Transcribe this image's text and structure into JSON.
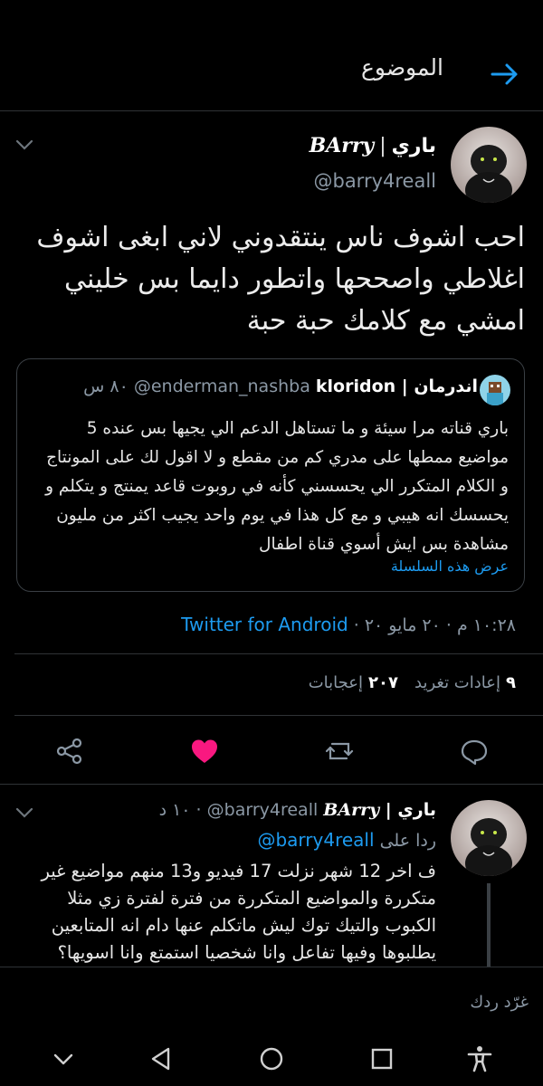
{
  "header": {
    "title": "الموضوع",
    "back_icon": "arrow-right-icon"
  },
  "tweet": {
    "display_name_ar": "باري",
    "display_name_sep": "|",
    "display_name_latin": "BArry",
    "handle": "@barry4reall",
    "body": "احب اشوف ناس ينتقدوني لاني ابغى اشوف اغلاطي واصححها واتطور دايما بس خليني امشي مع كلامك حبة حبة",
    "quote": {
      "name": "اندرمان | kloridon",
      "handle": "@enderman_nashba",
      "time": "٨٠ س",
      "body": "باري قناته مرا سيئة و ما تستاهل الدعم الي يجيها بس عنده 5 مواضيع ممطها على مدري كم من مقطع و لا اقول لك على المونتاج و الكلام المتكرر الي يحسسني كأنه في روبوت قاعد يمنتج و يتكلم و يحسسك انه هيبي و مع كل هذا في يوم واحد يجيب اكثر من مليون مشاهدة بس ايش أسوي قناة اطفال",
      "show_thread": "عرض هذه السلسلة"
    },
    "timestamp": "١٠:٢٨ م · ٢٠ مايو ٢٠ ·",
    "source": "Twitter for Android",
    "stats": {
      "retweets_count": "٩",
      "retweets_label": "إعادات تغريد",
      "likes_count": "٢٠٧",
      "likes_label": "إعجابات"
    },
    "liked_color": "#f91880"
  },
  "reply": {
    "display_name_ar": "باري",
    "display_name_sep": "|",
    "display_name_latin": "BArry",
    "handle": "@barry4reall",
    "time": "· ١٠ د",
    "replying_to_label": "ردا على",
    "replying_to_handle": "@barry4reall",
    "body": "ف اخر 12 شهر نزلت 17 فيديو و13 منهم مواضيع غير متكررة والمواضيع المتكررة من فترة لفترة زي مثلا الكبوب والتيك توك ليش ماتكلم عنها دام انه المتابعين يطلبوها وفيها تفاعل وانا شخصيا استمتع وانا اسويها؟في ناس"
  },
  "compose": {
    "placeholder": "غرّد ردك"
  },
  "colors": {
    "accent": "#1d9bf0",
    "background": "#000000",
    "muted": "#8b98a5"
  }
}
